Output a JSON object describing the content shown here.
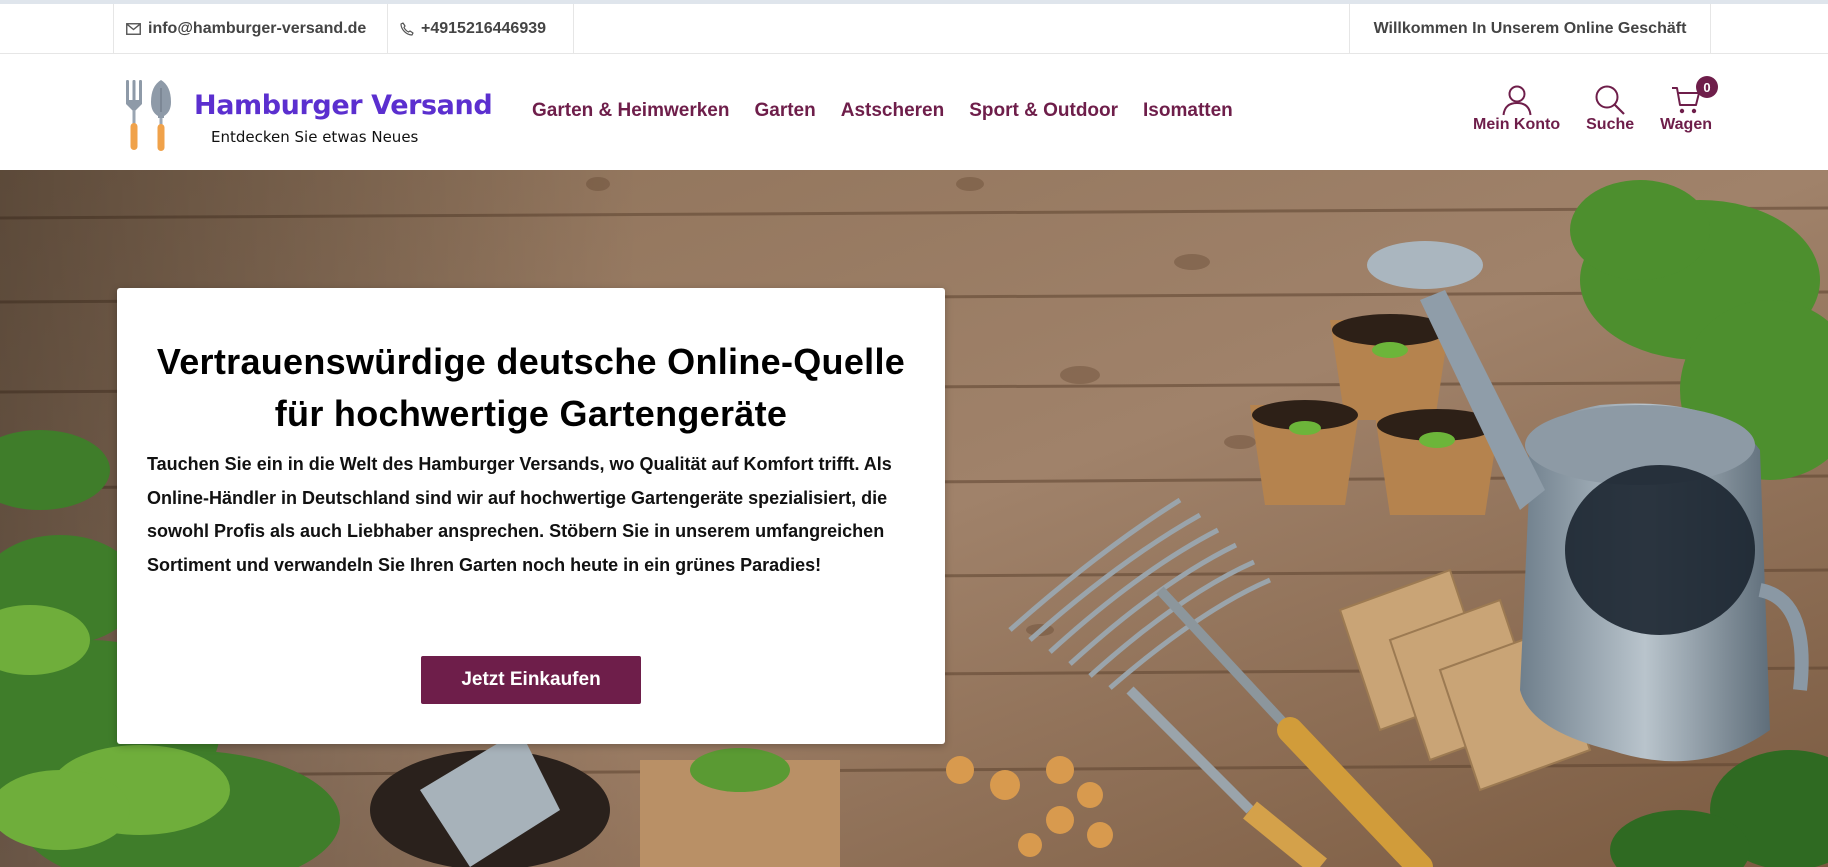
{
  "topbar": {
    "email": "info@hamburger-versand.de",
    "phone": "+4915216446939",
    "welcome": "Willkommen In Unserem Online Geschäft"
  },
  "brand": {
    "name": "Hamburger Versand",
    "tagline": "Entdecken Sie etwas Neues",
    "logo_icon": "garden-tools-icon"
  },
  "nav": {
    "items": [
      "Garten & Heimwerken",
      "Garten",
      "Astscheren",
      "Sport & Outdoor",
      "Isomatten"
    ]
  },
  "tools": {
    "account": "Mein Konto",
    "search": "Suche",
    "cart": "Wagen",
    "cart_count": "0"
  },
  "hero": {
    "title": "Vertrauenswürdige deutsche Online-Quelle für hochwertige Gartengeräte",
    "text": "Tauchen Sie ein in die Welt des Hamburger Versands, wo Qualität auf Komfort trifft. Als Online-Händler in Deutschland sind wir auf hochwertige Gartengeräte spezialisiert, die sowohl Profis als auch Liebhaber ansprechen. Stöbern Sie in unserem umfangreichen Sortiment und verwandeln Sie Ihren Garten noch heute in ein grünes Paradies!",
    "cta": "Jetzt Einkaufen",
    "background": "garden-tools-on-wooden-table"
  },
  "colors": {
    "accent": "#6e1e4a",
    "brand": "#5b2fcf"
  }
}
